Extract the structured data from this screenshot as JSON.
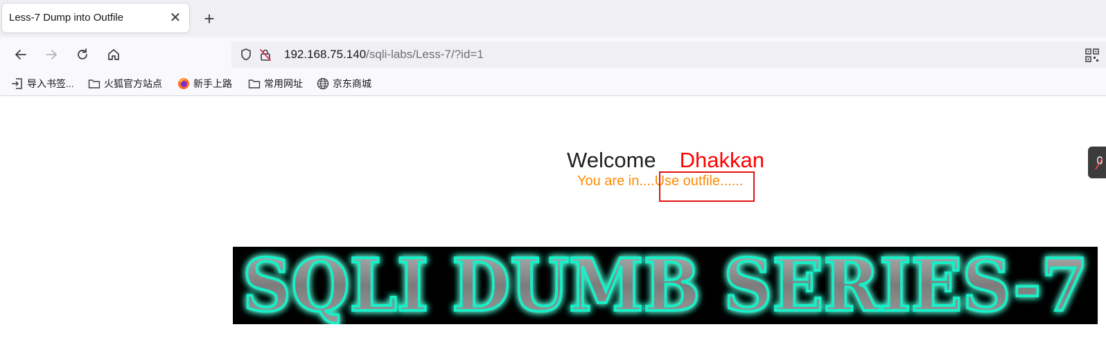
{
  "browser": {
    "tab_title": "Less-7 Dump into Outfile",
    "tab_close": "✕",
    "new_tab": "+",
    "url_host": "192.168.75.140",
    "url_path": "/sqli-labs/Less-7/?id=1"
  },
  "bookmarks": [
    {
      "label": "导入书签...",
      "icon": "import-icon"
    },
    {
      "label": "火狐官方站点",
      "icon": "folder-icon"
    },
    {
      "label": "新手上路",
      "icon": "firefox-icon"
    },
    {
      "label": "常用网址",
      "icon": "folder-icon"
    },
    {
      "label": "京东商城",
      "icon": "globe-icon"
    }
  ],
  "page": {
    "welcome": "Welcome",
    "user": "Dhakkan",
    "status_prefix": "You are in....",
    "status_hint": "Use outfile......",
    "banner_text": "SQLI DUMB SERIES-7"
  },
  "colors": {
    "user_name": "#ff0000",
    "status_text": "#ff8a00",
    "highlight_box": "#e01010",
    "banner_glow": "#19f0c8"
  }
}
